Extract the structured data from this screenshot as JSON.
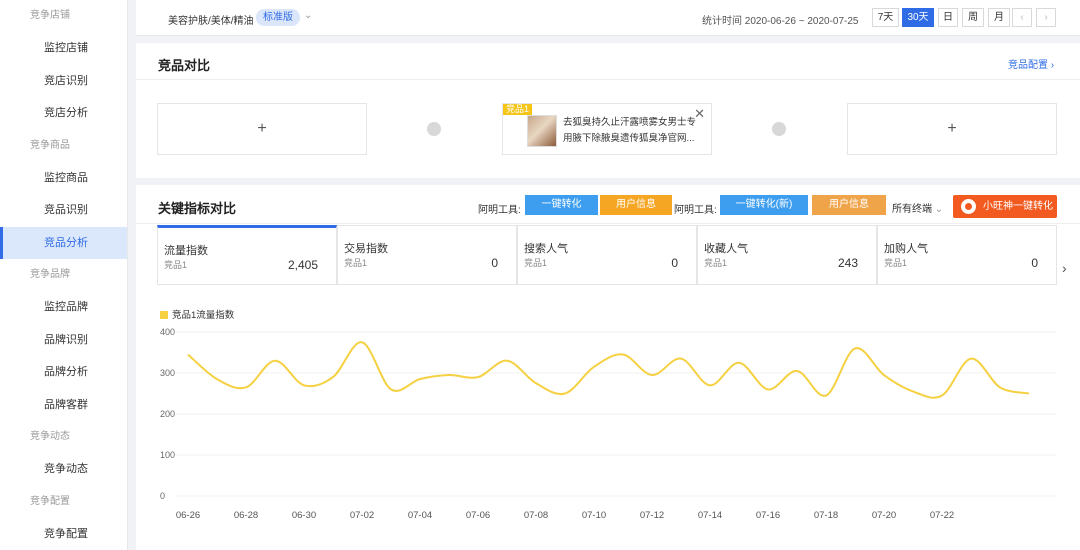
{
  "sidebar": {
    "items": [
      {
        "type": "group",
        "label": "竞争店铺"
      },
      {
        "type": "item",
        "label": "监控店铺"
      },
      {
        "type": "item",
        "label": "竞店识别"
      },
      {
        "type": "item",
        "label": "竞店分析"
      },
      {
        "type": "group",
        "label": "竞争商品"
      },
      {
        "type": "item",
        "label": "监控商品"
      },
      {
        "type": "item",
        "label": "竞品识别"
      },
      {
        "type": "item",
        "label": "竞品分析",
        "active": true
      },
      {
        "type": "group",
        "label": "竞争品牌"
      },
      {
        "type": "item",
        "label": "监控品牌"
      },
      {
        "type": "item",
        "label": "品牌识别"
      },
      {
        "type": "item",
        "label": "品牌分析"
      },
      {
        "type": "item",
        "label": "品牌客群"
      },
      {
        "type": "group",
        "label": "竞争动态"
      },
      {
        "type": "item",
        "label": "竞争动态"
      },
      {
        "type": "group",
        "label": "竞争配置"
      },
      {
        "type": "item",
        "label": "竞争配置"
      }
    ]
  },
  "topbar": {
    "category": "美容护肤/美体/精油",
    "edition": "标准版",
    "stat_time": "统计时间 2020-06-26 ~ 2020-07-25",
    "ranges": [
      "7天",
      "30天",
      "日",
      "周",
      "月"
    ],
    "active_range": "30天"
  },
  "compare": {
    "title": "竞品对比",
    "config_link": "竞品配置",
    "empty_slot": "+",
    "product": {
      "tag": "竞品1",
      "title": "去狐臭持久止汗露喷雾女男士专用腋下除腋臭遗传狐臭净官网..."
    }
  },
  "metrics_panel": {
    "title": "关键指标对比",
    "tool_label": "阿明工具:",
    "btn_convert": "一键转化",
    "btn_user_info": "用户信息",
    "btn_convert_new": "一键转化(新)",
    "all_channels": "所有终端",
    "robot_btn": "小旺神一键转化",
    "cards": [
      {
        "title": "流量指数",
        "sub": "竞品1",
        "value": "2,405"
      },
      {
        "title": "交易指数",
        "sub": "竞品1",
        "value": "0"
      },
      {
        "title": "搜索人气",
        "sub": "竞品1",
        "value": "0"
      },
      {
        "title": "收藏人气",
        "sub": "竞品1",
        "value": "243"
      },
      {
        "title": "加购人气",
        "sub": "竞品1",
        "value": "0"
      }
    ]
  },
  "chart_data": {
    "type": "line",
    "series": [
      {
        "name": "竞品1流量指数",
        "color": "#f5d142",
        "values": [
          345,
          285,
          265,
          330,
          270,
          290,
          375,
          260,
          285,
          295,
          290,
          330,
          275,
          250,
          315,
          345,
          295,
          335,
          270,
          325,
          260,
          305,
          245,
          360,
          295,
          255,
          245,
          335,
          265,
          250
        ]
      }
    ],
    "x": [
      "06-26",
      "06-27",
      "06-28",
      "06-29",
      "06-30",
      "07-01",
      "07-02",
      "07-03",
      "07-04",
      "07-05",
      "07-06",
      "07-07",
      "07-08",
      "07-09",
      "07-10",
      "07-11",
      "07-12",
      "07-13",
      "07-14",
      "07-15",
      "07-16",
      "07-17",
      "07-18",
      "07-19",
      "07-20",
      "07-21",
      "07-22",
      "07-23",
      "07-24",
      "07-25"
    ],
    "x_tick_labels": [
      "06-26",
      "06-28",
      "06-30",
      "07-02",
      "07-04",
      "07-06",
      "07-08",
      "07-10",
      "07-12",
      "07-14",
      "07-16",
      "07-18",
      "07-20",
      "07-22"
    ],
    "y_ticks": [
      "400",
      "300",
      "200",
      "100",
      "0"
    ],
    "ylim": [
      0,
      400
    ],
    "grid": true,
    "legend": "top-left"
  }
}
